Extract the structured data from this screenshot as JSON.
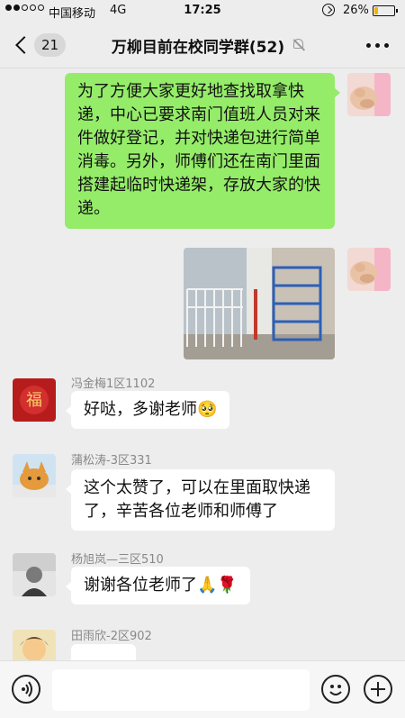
{
  "status_bar": {
    "carrier": "中国移动",
    "network": "4G",
    "time": "17:25",
    "battery_percent": "26%",
    "battery_level": 0.26,
    "battery_color": "#f3b200"
  },
  "header": {
    "back_icon": "chevron-left-icon",
    "unread_count": "21",
    "title": "万柳目前在校同学群(52)",
    "muted_icon": "bell-off-icon",
    "more_icon": "more-dots-icon"
  },
  "messages": [
    {
      "from": "me",
      "type": "text",
      "text": "为了方便大家更好地查找取拿快递，中心已要求南门值班人员对来件做好登记，并对快递包进行简单消毒。另外，师傅们还在南门里面搭建起临时快递架，存放大家的快递。"
    },
    {
      "from": "me",
      "type": "image"
    },
    {
      "from": "other",
      "sender": "冯金梅1区1102",
      "text": "好哒，多谢老师",
      "emoji": "🥺"
    },
    {
      "from": "other",
      "sender": "蒲松涛-3区331",
      "text": "这个太赞了，可以在里面取快递了，辛苦各位老师和师傅了"
    },
    {
      "from": "other",
      "sender": "杨旭岚—三区510",
      "text": "谢谢各位老师了",
      "emoji": "🙏🌹"
    },
    {
      "from": "other",
      "sender": "田雨欣-2区902"
    }
  ],
  "input_bar": {
    "voice_icon": "voice-icon",
    "emoji_icon": "smiley-icon",
    "add_icon": "plus-icon"
  },
  "colors": {
    "my_bubble": "#95ec69",
    "other_bubble": "#ffffff",
    "background": "#ededed"
  }
}
